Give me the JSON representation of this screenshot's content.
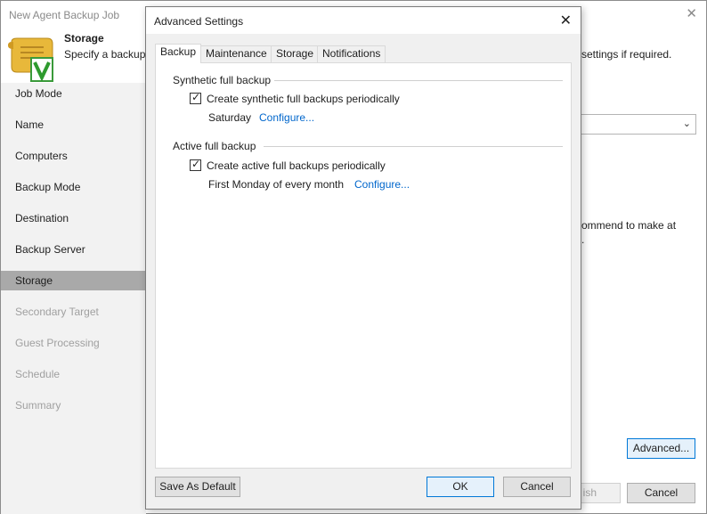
{
  "wizard": {
    "title": "New Agent Backup Job",
    "close_glyph": "✕",
    "header_title": "Storage",
    "header_desc": "Specify a backup",
    "header_desc_right": "settings if required.",
    "right_text_1": "ommend to make at",
    "right_text_2": ".",
    "advanced_label": "Advanced...",
    "finish_label": "ish",
    "cancel_label": "Cancel"
  },
  "sidebar": {
    "items": [
      {
        "label": "Job Mode"
      },
      {
        "label": "Name"
      },
      {
        "label": "Computers"
      },
      {
        "label": "Backup Mode"
      },
      {
        "label": "Destination"
      },
      {
        "label": "Backup Server"
      },
      {
        "label": "Storage"
      },
      {
        "label": "Secondary Target"
      },
      {
        "label": "Guest Processing"
      },
      {
        "label": "Schedule"
      },
      {
        "label": "Summary"
      }
    ]
  },
  "dialog": {
    "title": "Advanced Settings",
    "close_glyph": "✕",
    "tabs": [
      {
        "label": "Backup"
      },
      {
        "label": "Maintenance"
      },
      {
        "label": "Storage"
      },
      {
        "label": "Notifications"
      }
    ],
    "synthetic": {
      "group_title": "Synthetic full backup",
      "checkbox_label": "Create synthetic full backups periodically",
      "checked": true,
      "schedule_text": "Saturday",
      "configure_label": "Configure..."
    },
    "active": {
      "group_title": "Active full backup",
      "checkbox_label": "Create active full backups periodically",
      "checked": true,
      "schedule_text": "First Monday of every month",
      "configure_label": "Configure..."
    },
    "save_default_label": "Save As Default",
    "ok_label": "OK",
    "cancel_label": "Cancel"
  },
  "icons": {
    "check_glyph": "✓",
    "chevron_glyph": "⌄"
  },
  "colors": {
    "link": "#0066cc",
    "active_sidebar": "#a9a9a9",
    "focus_border": "#0078d7"
  }
}
